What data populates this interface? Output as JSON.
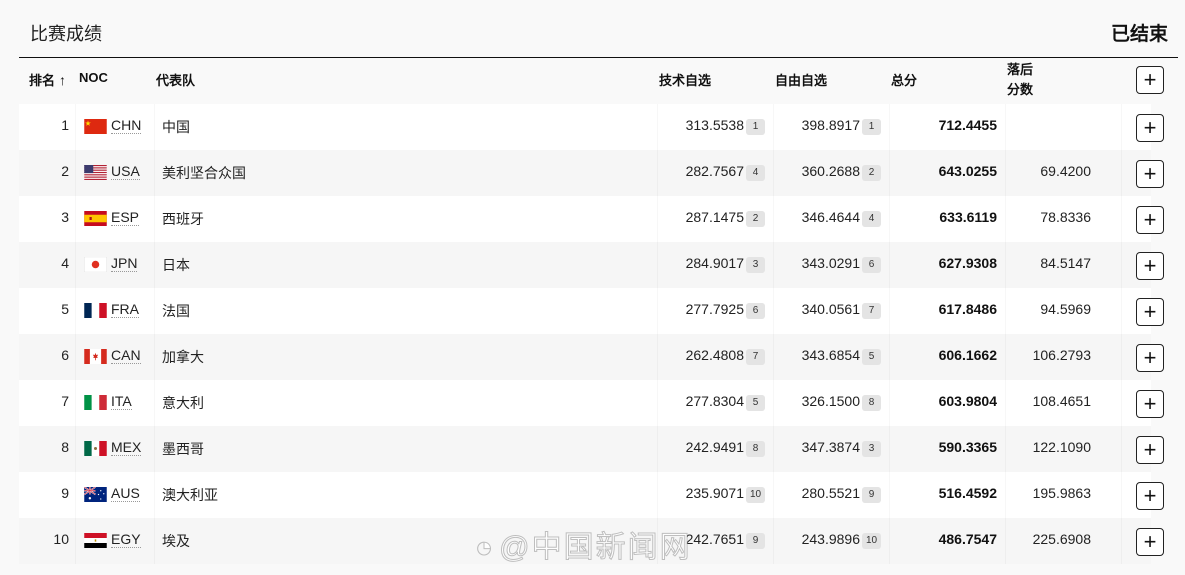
{
  "header": {
    "title": "比赛成绩",
    "status": "已结束"
  },
  "table": {
    "columns": {
      "rank": "排名",
      "sort_arrow": "↑",
      "noc": "NOC",
      "team": "代表队",
      "technical": "技术自选",
      "free": "自由自选",
      "total": "总分",
      "behind_line1": "落后",
      "behind_line2": "分数",
      "expand": "+"
    },
    "rows": [
      {
        "rank": "1",
        "noc": "CHN",
        "flag": "china-flag",
        "team": "中国",
        "technical": "313.5538",
        "technical_rank": "1",
        "free": "398.8917",
        "free_rank": "1",
        "total": "712.4455",
        "behind": "",
        "expand": "+"
      },
      {
        "rank": "2",
        "noc": "USA",
        "flag": "usa-flag",
        "team": "美利坚合众国",
        "technical": "282.7567",
        "technical_rank": "4",
        "free": "360.2688",
        "free_rank": "2",
        "total": "643.0255",
        "behind": "69.4200",
        "expand": "+"
      },
      {
        "rank": "3",
        "noc": "ESP",
        "flag": "spain-flag",
        "team": "西班牙",
        "technical": "287.1475",
        "technical_rank": "2",
        "free": "346.4644",
        "free_rank": "4",
        "total": "633.6119",
        "behind": "78.8336",
        "expand": "+"
      },
      {
        "rank": "4",
        "noc": "JPN",
        "flag": "japan-flag",
        "team": "日本",
        "technical": "284.9017",
        "technical_rank": "3",
        "free": "343.0291",
        "free_rank": "6",
        "total": "627.9308",
        "behind": "84.5147",
        "expand": "+"
      },
      {
        "rank": "5",
        "noc": "FRA",
        "flag": "france-flag",
        "team": "法国",
        "technical": "277.7925",
        "technical_rank": "6",
        "free": "340.0561",
        "free_rank": "7",
        "total": "617.8486",
        "behind": "94.5969",
        "expand": "+"
      },
      {
        "rank": "6",
        "noc": "CAN",
        "flag": "canada-flag",
        "team": "加拿大",
        "technical": "262.4808",
        "technical_rank": "7",
        "free": "343.6854",
        "free_rank": "5",
        "total": "606.1662",
        "behind": "106.2793",
        "expand": "+"
      },
      {
        "rank": "7",
        "noc": "ITA",
        "flag": "italy-flag",
        "team": "意大利",
        "technical": "277.8304",
        "technical_rank": "5",
        "free": "326.1500",
        "free_rank": "8",
        "total": "603.9804",
        "behind": "108.4651",
        "expand": "+"
      },
      {
        "rank": "8",
        "noc": "MEX",
        "flag": "mexico-flag",
        "team": "墨西哥",
        "technical": "242.9491",
        "technical_rank": "8",
        "free": "347.3874",
        "free_rank": "3",
        "total": "590.3365",
        "behind": "122.1090",
        "expand": "+"
      },
      {
        "rank": "9",
        "noc": "AUS",
        "flag": "australia-flag",
        "team": "澳大利亚",
        "technical": "235.9071",
        "technical_rank": "10",
        "free": "280.5521",
        "free_rank": "9",
        "total": "516.4592",
        "behind": "195.9863",
        "expand": "+"
      },
      {
        "rank": "10",
        "noc": "EGY",
        "flag": "egypt-flag",
        "team": "埃及",
        "technical": "242.7651",
        "technical_rank": "9",
        "free": "243.9896",
        "free_rank": "10",
        "total": "486.7547",
        "behind": "225.6908",
        "expand": "+"
      }
    ]
  },
  "watermark": {
    "text": "@中国新闻网",
    "icon": "weibo-icon"
  }
}
